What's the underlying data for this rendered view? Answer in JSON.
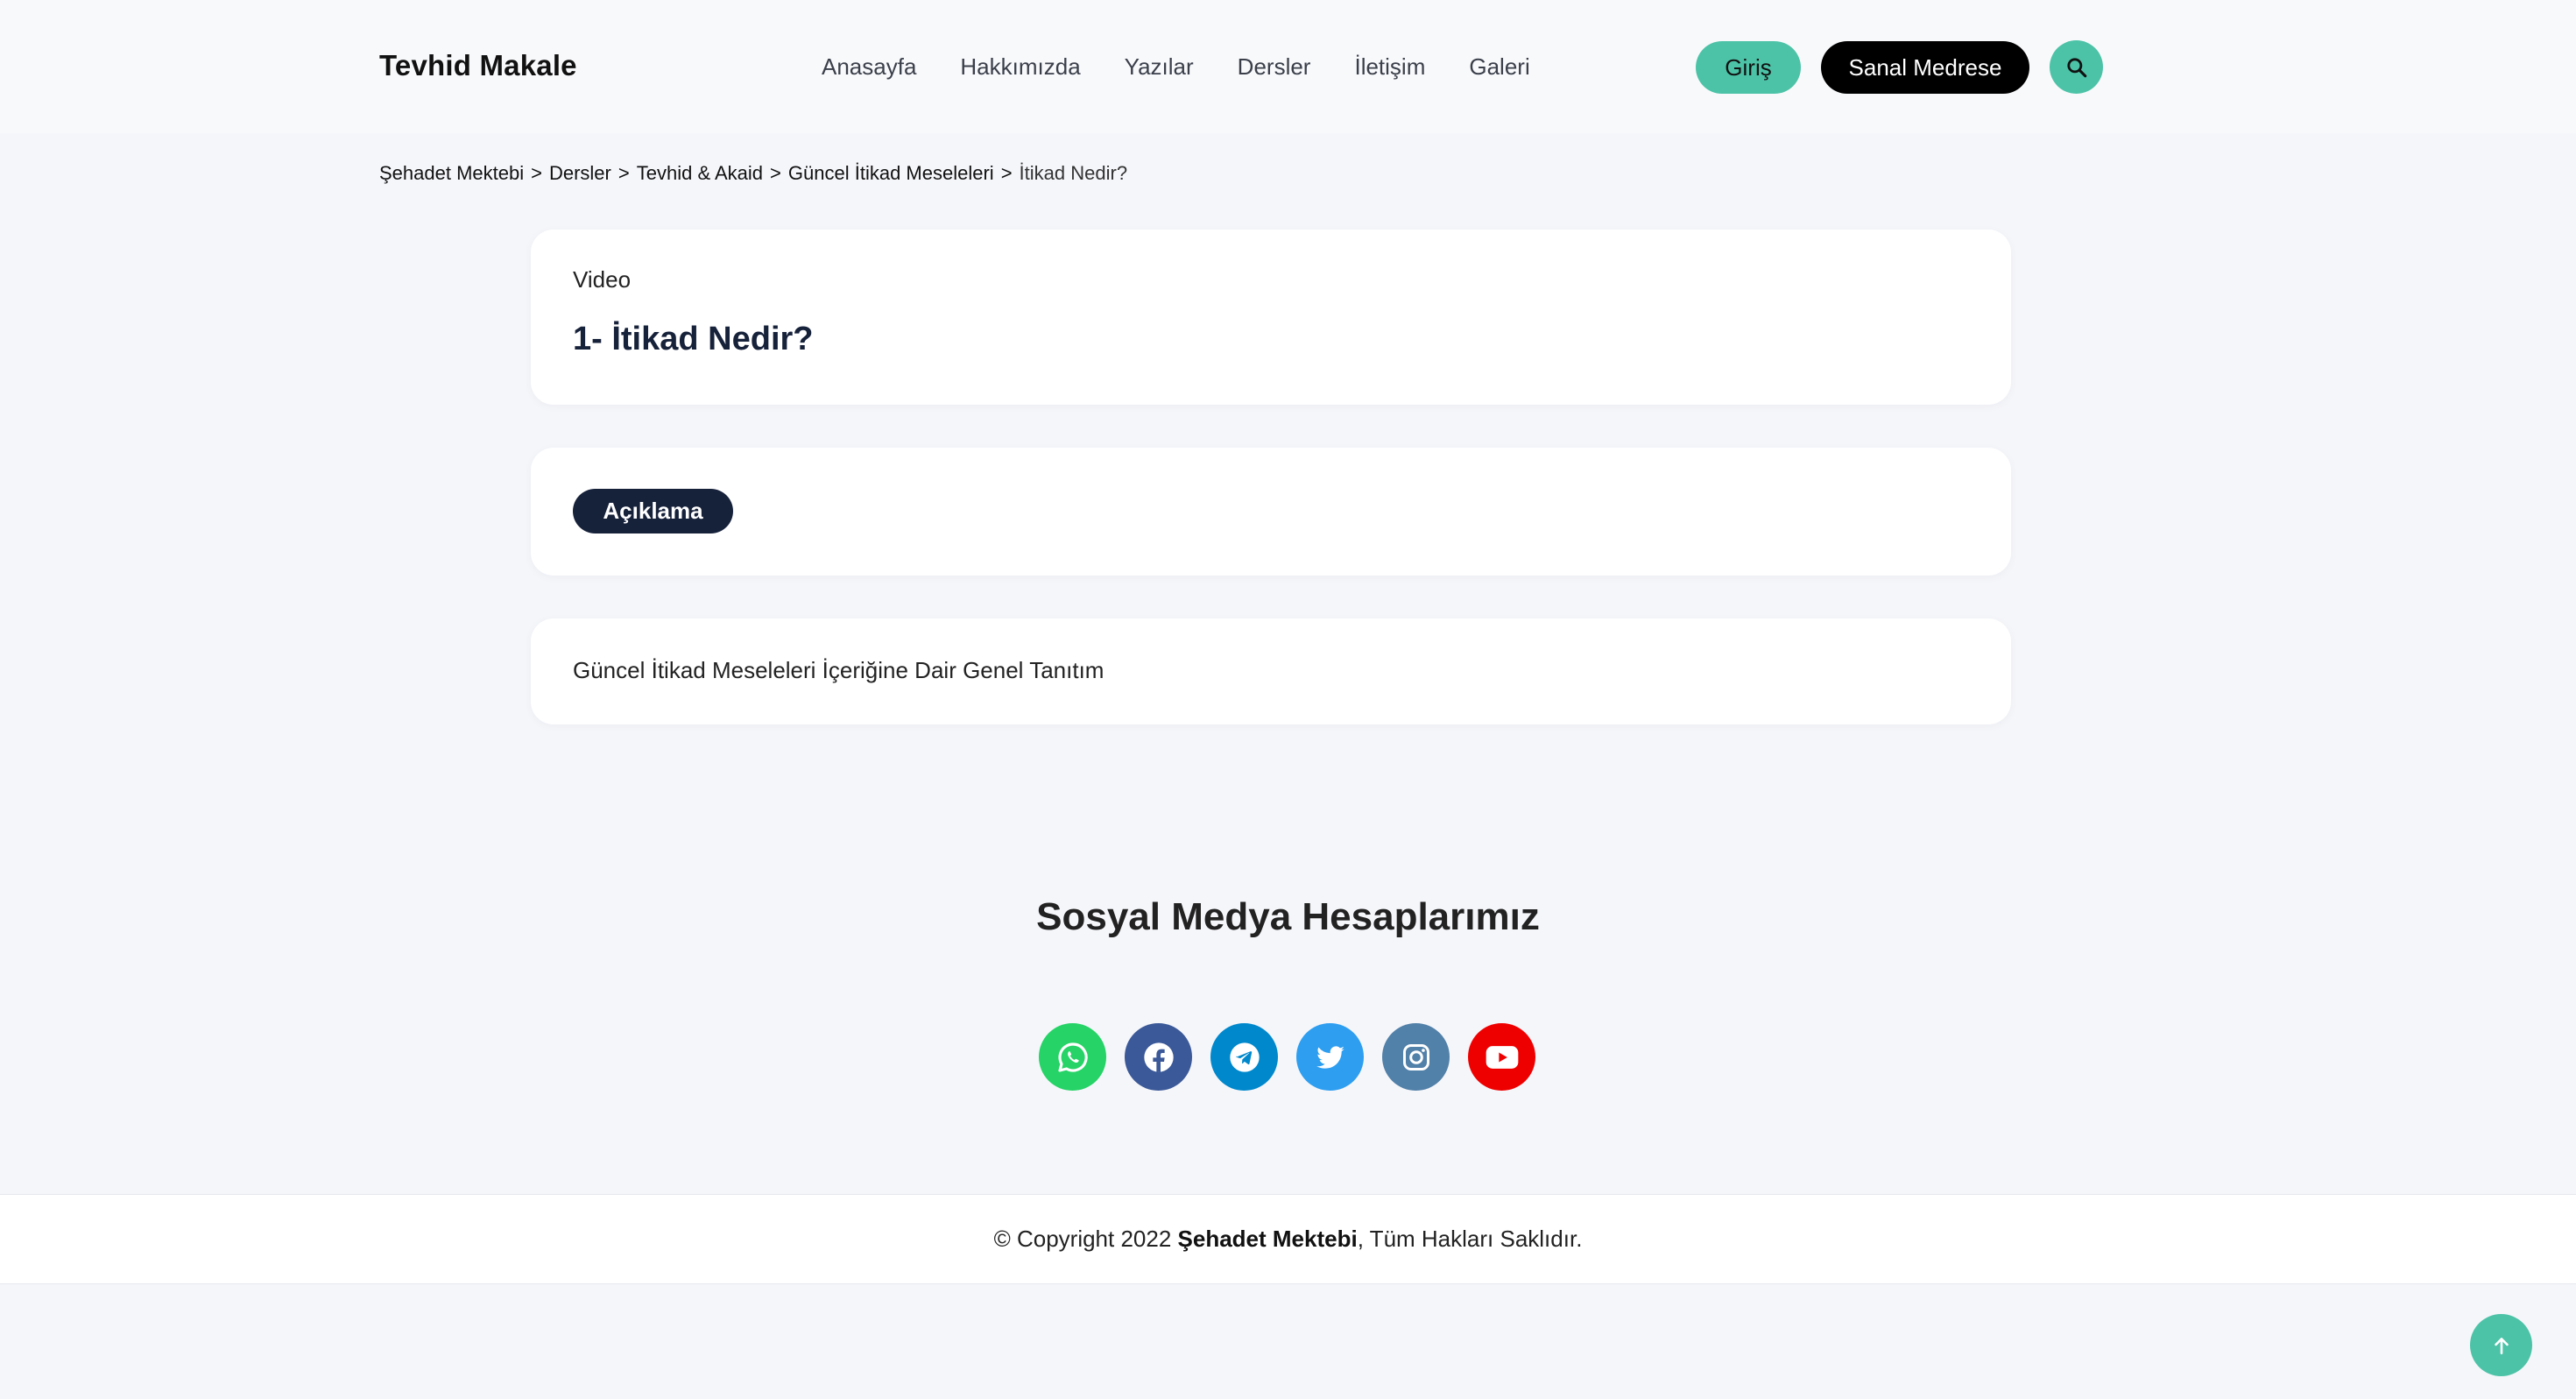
{
  "header": {
    "brand": "Tevhid Makale",
    "nav": [
      "Anasayfa",
      "Hakkımızda",
      "Yazılar",
      "Dersler",
      "İletişim",
      "Galeri"
    ],
    "login_label": "Giriş",
    "medrese_label": "Sanal Medrese",
    "search_icon": "search-icon"
  },
  "breadcrumb": {
    "items": [
      "Şehadet Mektebi",
      "Dersler",
      "Tevhid & Akaid",
      "Güncel İtikad Meseleleri",
      "İtikad Nedir?"
    ],
    "separator": ">"
  },
  "lesson": {
    "type_label": "Video",
    "title": "1- İtikad Nedir?",
    "description_tab": "Açıklama",
    "description_text": "Güncel İtikad Meseleleri İçeriğine Dair Genel Tanıtım"
  },
  "social": {
    "title": "Sosyal Medya Hesaplarımız",
    "icons": [
      {
        "name": "whatsapp-icon",
        "color": "#25d366"
      },
      {
        "name": "facebook-icon",
        "color": "#3b5998"
      },
      {
        "name": "telegram-icon",
        "color": "#0088cc"
      },
      {
        "name": "twitter-icon",
        "color": "#2d9ef0"
      },
      {
        "name": "instagram-icon",
        "color": "#5180a8"
      },
      {
        "name": "youtube-icon",
        "color": "#ef0000"
      }
    ]
  },
  "footer": {
    "prefix": "© Copyright 2022 ",
    "org": "Şehadet Mektebi",
    "suffix": ", Tüm Hakları Saklıdır."
  },
  "colors": {
    "accent": "#4cc3a7",
    "dark": "#16213a",
    "background": "#f5f6fa"
  },
  "back_to_top_icon": "arrow-up-icon"
}
